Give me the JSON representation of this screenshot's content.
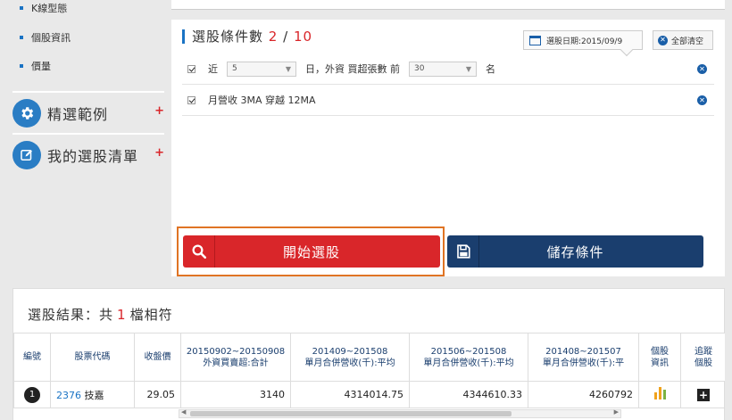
{
  "sidebar": {
    "sub_items": [
      "K線型態",
      "個股資訊",
      "價量"
    ],
    "groups": [
      {
        "label": "精選範例",
        "icon": "gear-icon"
      },
      {
        "label": "我的選股清單",
        "icon": "edit-icon"
      }
    ],
    "plus": "+"
  },
  "panel": {
    "title_prefix": "選股條件數",
    "count": "2",
    "separator": "/",
    "max": "10",
    "date_label": "選股日期:2015/09/9",
    "clear_label": "全部清空",
    "conditions": [
      {
        "pre": "近",
        "select1": "5",
        "mid": "日，外資 買超張數 前",
        "select2": "30",
        "post": "名"
      },
      {
        "text": "月營收 3MA 穿越 12MA"
      }
    ],
    "start_label": "開始選股",
    "save_label": "儲存條件"
  },
  "results": {
    "title_prefix": "選股結果：共",
    "count": "1",
    "title_suffix": "檔相符",
    "columns": [
      [
        "編號"
      ],
      [
        "股票代碼"
      ],
      [
        "收盤價"
      ],
      [
        "20150902~20150908",
        "外資買賣超:合計"
      ],
      [
        "201409~201508",
        "單月合併營收(千):平均"
      ],
      [
        "201506~201508",
        "單月合併營收(千):平均"
      ],
      [
        "201408~201507",
        "單月合併營收(千):平"
      ],
      [
        "個股",
        "資訊"
      ],
      [
        "追蹤",
        "個股"
      ]
    ],
    "rows": [
      {
        "rank": "1",
        "code": "2376",
        "name": "技嘉",
        "close": "29.05",
        "foreign": "3140",
        "rev1": "4314014.75",
        "rev2": "4344610.33",
        "rev3": "4260792"
      }
    ],
    "colors": {
      "bar_orange": "#f0a21c",
      "bar_green": "#7cb342"
    }
  },
  "colors": {
    "accent_red": "#d9262a",
    "navy": "#1a3e6e",
    "blue": "#1a73c4",
    "highlight": "#e07424"
  }
}
